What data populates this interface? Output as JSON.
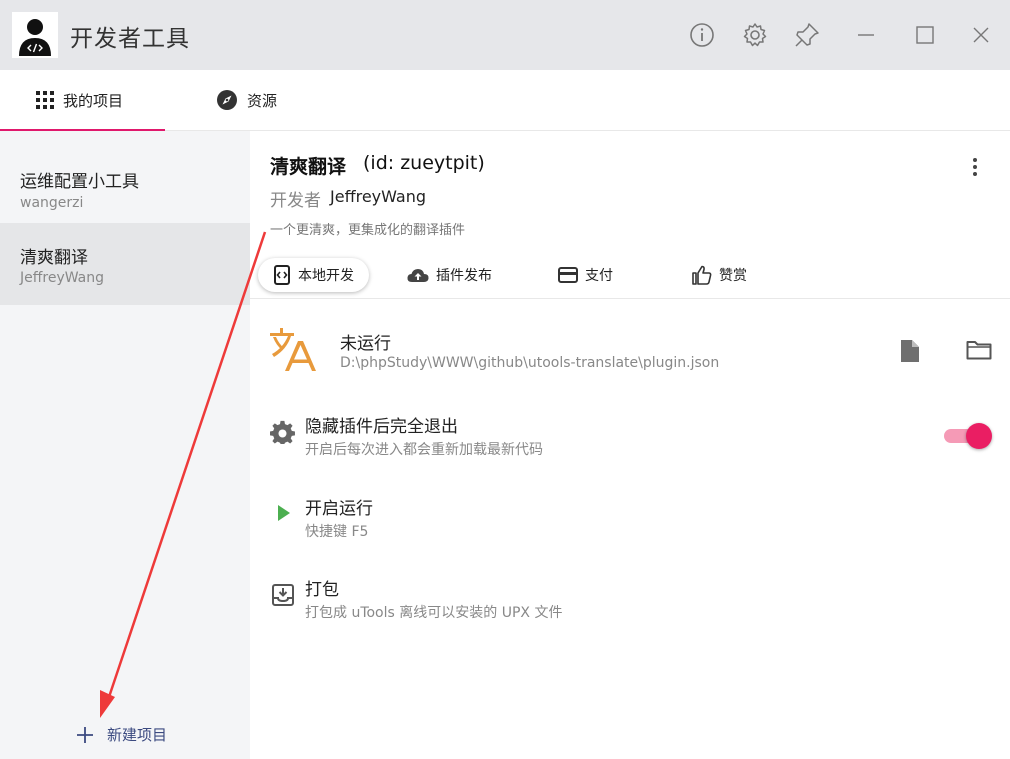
{
  "app": {
    "title": "开发者工具"
  },
  "nav": {
    "tabs": [
      {
        "label": "我的项目"
      },
      {
        "label": "资源"
      }
    ]
  },
  "sidebar": {
    "projects": [
      {
        "name": "运维配置小工具",
        "author": "wangerzi"
      },
      {
        "name": "清爽翻译",
        "author": "JeffreyWang"
      }
    ],
    "new_project_label": "新建项目"
  },
  "project": {
    "name": "清爽翻译",
    "id_text": "(id: zueytpit)",
    "developer_label": "开发者",
    "developer_name": "JeffreyWang",
    "description": "一个更清爽，更集成化的翻译插件"
  },
  "sub_tabs": [
    {
      "label": "本地开发"
    },
    {
      "label": "插件发布"
    },
    {
      "label": "支付"
    },
    {
      "label": "赞赏"
    }
  ],
  "status": {
    "text": "未运行",
    "path": "D:\\phpStudy\\WWW\\github\\utools-translate\\plugin.json"
  },
  "options": [
    {
      "title": "隐藏插件后完全退出",
      "subtitle": "开启后每次进入都会重新加载最新代码",
      "toggle_on": true
    },
    {
      "title": "开启运行",
      "subtitle": "快捷键 F5"
    },
    {
      "title": "打包",
      "subtitle": "打包成 uTools 离线可以安装的 UPX 文件"
    }
  ],
  "colors": {
    "accent": "#e0186c",
    "toggle": "#ea1e63",
    "play": "#4caf50",
    "translate_icon": "#e89a3c"
  }
}
